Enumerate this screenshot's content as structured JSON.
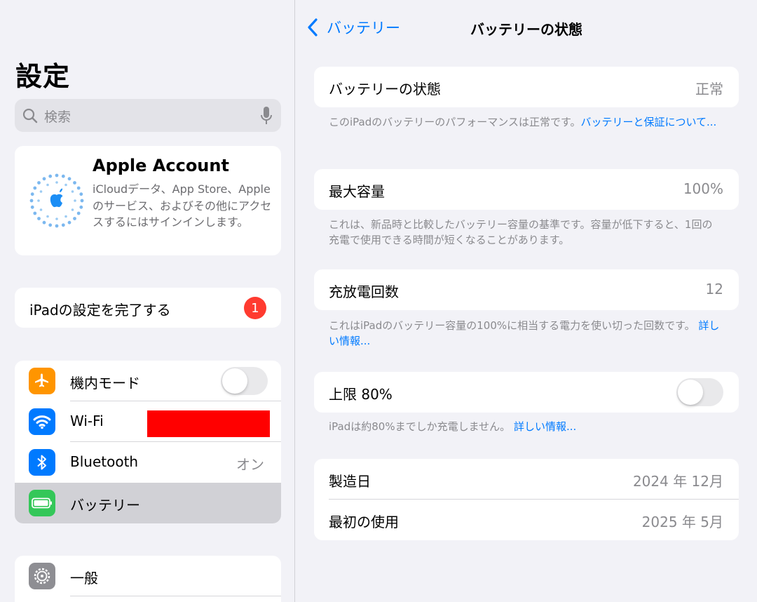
{
  "sidebar": {
    "title": "設定",
    "search": {
      "placeholder": "検索"
    },
    "account": {
      "name": "Apple Account",
      "description": "iCloudデータ、App Store、Appleのサービス、およびその他にアクセスするにはサインインします。"
    },
    "setup": {
      "label": "iPadの設定を完了する",
      "badge": "1"
    },
    "items": [
      {
        "label": "機内モード",
        "icon": "airplane-icon",
        "color": "#ff9500",
        "toggle_on": false
      },
      {
        "label": "Wi-Fi",
        "icon": "wifi-icon",
        "color": "#007aff",
        "value": ""
      },
      {
        "label": "Bluetooth",
        "icon": "bluetooth-icon",
        "color": "#007aff",
        "value": "オン"
      },
      {
        "label": "バッテリー",
        "icon": "battery-icon",
        "color": "#34c759",
        "selected": true
      }
    ],
    "general": {
      "label": "一般",
      "icon": "gear-icon",
      "color": "#8e8e93"
    }
  },
  "detail": {
    "back_label": "バッテリー",
    "title": "バッテリーの状態",
    "health": {
      "label": "バッテリーの状態",
      "value": "正常",
      "note": "このiPadのバッテリーのパフォーマンスは正常です。",
      "note_link": "バッテリーと保証について..."
    },
    "capacity": {
      "label": "最大容量",
      "value": "100%",
      "note": "これは、新品時と比較したバッテリー容量の基準です。容量が低下すると、1回の充電で使用できる時間が短くなることがあります。"
    },
    "cycles": {
      "label": "充放電回数",
      "value": "12",
      "note": "これはiPadのバッテリー容量の100%に相当する電力を使い切った回数です。",
      "note_link": "詳しい情報..."
    },
    "limit": {
      "label": "上限 80%",
      "toggle_on": false,
      "note": "iPadは約80%までしか充電しません。",
      "note_link": "詳しい情報..."
    },
    "manufacture": {
      "label": "製造日",
      "value": "2024 年 12月"
    },
    "first_use": {
      "label": "最初の使用",
      "value": "2025 年 5月"
    }
  },
  "colors": {
    "accent": "#007aff",
    "badge": "#ff3b30",
    "redaction": "#ff0000"
  }
}
